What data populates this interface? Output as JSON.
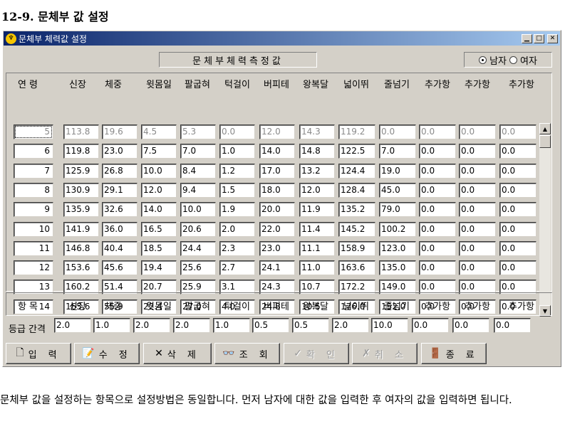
{
  "doc": {
    "heading": "12-9. 문체부 값 설정",
    "paragraph": "문체부 값을 설정하는 항목으로 설정방법은 동일합니다. 먼저 남자에 대한 값을 입력한 후 여자의 값을 입력하면 됩니다."
  },
  "window": {
    "title": "문체부 체력값 설정",
    "caption": "문체부체력측정값",
    "gender": {
      "male": "남자",
      "female": "여자",
      "selected": "male"
    }
  },
  "columns": [
    "연 령",
    "신장",
    "체중",
    "윗몸일",
    "팔굽혀",
    "턱걸이",
    "버피테",
    "왕복달",
    "넓이뛰",
    "줄넘기",
    "추가항",
    "추가항",
    "추가항"
  ],
  "rows": [
    [
      "5",
      "113.8",
      "19.6",
      "4.5",
      "5.3",
      "0.0",
      "12.0",
      "14.3",
      "119.2",
      "0.0",
      "0.0",
      "0.0",
      "0.0"
    ],
    [
      "6",
      "119.8",
      "23.0",
      "7.5",
      "7.0",
      "1.0",
      "14.0",
      "14.8",
      "122.5",
      "7.0",
      "0.0",
      "0.0",
      "0.0"
    ],
    [
      "7",
      "125.9",
      "26.8",
      "10.0",
      "8.4",
      "1.2",
      "17.0",
      "13.2",
      "124.4",
      "19.0",
      "0.0",
      "0.0",
      "0.0"
    ],
    [
      "8",
      "130.9",
      "29.1",
      "12.0",
      "9.4",
      "1.5",
      "18.0",
      "12.0",
      "128.4",
      "45.0",
      "0.0",
      "0.0",
      "0.0"
    ],
    [
      "9",
      "135.9",
      "32.6",
      "14.0",
      "10.0",
      "1.9",
      "20.0",
      "11.9",
      "135.2",
      "79.0",
      "0.0",
      "0.0",
      "0.0"
    ],
    [
      "10",
      "141.9",
      "36.0",
      "16.5",
      "20.6",
      "2.0",
      "22.0",
      "11.4",
      "145.2",
      "100.2",
      "0.0",
      "0.0",
      "0.0"
    ],
    [
      "11",
      "146.8",
      "40.4",
      "18.5",
      "24.4",
      "2.3",
      "23.0",
      "11.1",
      "158.9",
      "123.0",
      "0.0",
      "0.0",
      "0.0"
    ],
    [
      "12",
      "153.6",
      "45.6",
      "19.4",
      "25.6",
      "2.7",
      "24.1",
      "11.0",
      "163.6",
      "135.0",
      "0.0",
      "0.0",
      "0.0"
    ],
    [
      "13",
      "160.2",
      "51.4",
      "20.7",
      "25.9",
      "3.1",
      "24.3",
      "10.7",
      "172.2",
      "149.0",
      "0.0",
      "0.0",
      "0.0"
    ],
    [
      "14",
      "165.6",
      "55.9",
      "22.4",
      "27.0",
      "4.0",
      "24.8",
      "10.5",
      "176.0",
      "152.0",
      "0.0",
      "0.0",
      "0.0"
    ]
  ],
  "item_header": [
    "항 목",
    "신장",
    "체중",
    "윗몸일",
    "팔굽혀",
    "턱걸이",
    "버피테",
    "왕복달",
    "넓이뛰",
    "줄넘기",
    "추가항",
    "추가항",
    "추가항"
  ],
  "grade": {
    "label": "등급 간격",
    "values": [
      "2.0",
      "1.0",
      "2.0",
      "2.0",
      "1.0",
      "0.5",
      "0.5",
      "2.0",
      "10.0",
      "0.0",
      "0.0",
      "0.0"
    ]
  },
  "buttons": [
    {
      "label": "입 력",
      "icon": "document-icon",
      "glyph": "🗋",
      "enabled": true
    },
    {
      "label": "수 정",
      "icon": "edit-icon",
      "glyph": "📝",
      "enabled": true
    },
    {
      "label": "삭 제",
      "icon": "delete-icon",
      "glyph": "✕",
      "enabled": true
    },
    {
      "label": "조 회",
      "icon": "binoculars-icon",
      "glyph": "👓",
      "enabled": true
    },
    {
      "label": "확 인",
      "icon": "check-icon",
      "glyph": "✓",
      "enabled": false
    },
    {
      "label": "취 소",
      "icon": "cancel-icon",
      "glyph": "✗",
      "enabled": false
    },
    {
      "label": "종 료",
      "icon": "exit-icon",
      "glyph": "🚪",
      "enabled": true
    }
  ]
}
